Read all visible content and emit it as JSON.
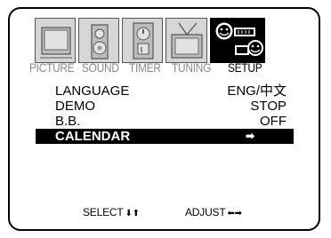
{
  "tabs": [
    {
      "label": "PICTURE",
      "icon": "monitor-icon",
      "active": false
    },
    {
      "label": "SOUND",
      "icon": "speaker-icon",
      "active": false
    },
    {
      "label": "TIMER",
      "icon": "timer-icon",
      "active": false
    },
    {
      "label": "TUNING",
      "icon": "antenna-tv-icon",
      "active": false
    },
    {
      "label": "SETUP",
      "icon": "setup-faces-icon",
      "active": true
    }
  ],
  "menu": [
    {
      "label": "LANGUAGE",
      "value": "ENG/中文"
    },
    {
      "label": "DEMO",
      "value": "STOP"
    },
    {
      "label": "B.B.",
      "value": "OFF"
    },
    {
      "label": "CALENDAR",
      "value": "➡",
      "selected": true
    }
  ],
  "footer": {
    "select_label": "SELECT",
    "select_arrows": "⬇⬆",
    "adjust_label": "ADJUST",
    "adjust_arrows": "⬅➡"
  },
  "colors": {
    "selected_bg": "#000000",
    "inactive_tab": "#8a8a8a"
  }
}
